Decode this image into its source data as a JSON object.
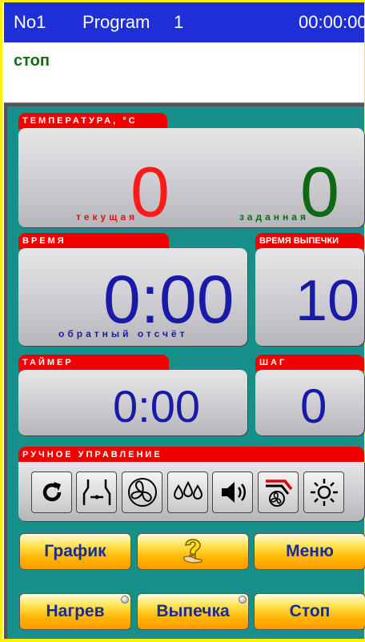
{
  "header": {
    "unit": "No1",
    "program_label": "Program",
    "program_number": "1",
    "time": "00:00:00"
  },
  "status": {
    "text": "стоп"
  },
  "temperature": {
    "title": "ТЕМПЕРАТУРА, °С",
    "current": "0",
    "current_label": "текущая",
    "target": "0",
    "target_label": "заданная",
    "current_color": "#ff1a1a",
    "target_color": "#0d6a14"
  },
  "time_panel": {
    "title": "ВРЕМЯ",
    "value": "0:00",
    "caption": "обратный отсчёт",
    "value_color": "#1a1aa8"
  },
  "bake_time": {
    "title": "ВРЕМЯ ВЫПЕЧКИ",
    "value": "10"
  },
  "timer": {
    "title": "ТАЙМЕР",
    "value": "0:00"
  },
  "step": {
    "title": "ШАГ",
    "value": "0"
  },
  "manual": {
    "title": "РУЧНОЕ УПРАВЛЕНИЕ",
    "tools": [
      "rotate-icon",
      "damper-icon",
      "fan-icon",
      "steam-drops-icon",
      "speaker-icon",
      "fan-heating-icon",
      "light-icon"
    ]
  },
  "buttons": {
    "graph": "График",
    "help_icon": "question-hand-icon",
    "menu": "Меню",
    "heat": "Нагрев",
    "bake": "Выпечка",
    "stop": "Стоп"
  },
  "colors": {
    "title_bg": "#1e2fd8",
    "panel_bg": "#17908b",
    "tab_red": "#f20000",
    "accent_yellow": "#fff200"
  }
}
